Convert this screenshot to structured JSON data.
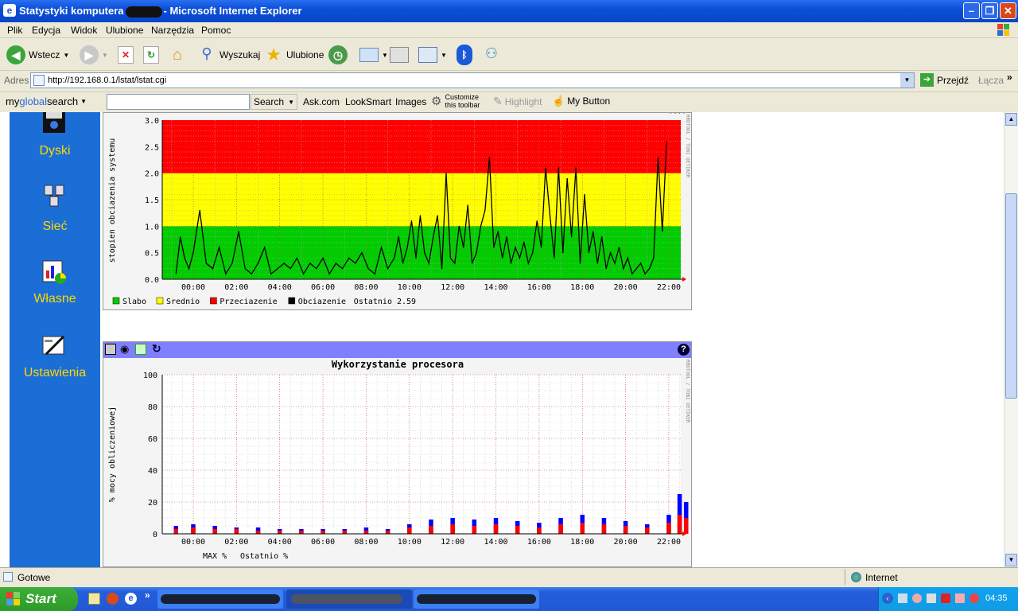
{
  "window": {
    "title_before": "Statystyki komputera",
    "title_after": "- Microsoft Internet Explorer"
  },
  "menu": [
    "Plik",
    "Edycja",
    "Widok",
    "Ulubione",
    "Narzędzia",
    "Pomoc"
  ],
  "toolbar": {
    "back_label": "Wstecz",
    "search_label": "Wyszukaj",
    "favorites_label": "Ulubione"
  },
  "address": {
    "label": "Adres",
    "url": "http://192.168.0.1/lstat/lstat.cgi",
    "go_label": "Przejdź",
    "links_label": "Łącza"
  },
  "searchbar": {
    "brand_my": "my",
    "brand_global": "global",
    "brand_search": "search",
    "search_button": "Search",
    "ask": "Ask.com",
    "looksmart": "LookSmart",
    "images": "Images",
    "customize_line1": "Customize",
    "customize_line2": "this toolbar",
    "highlight": "Highlight",
    "mybutton": "My Button"
  },
  "nav": [
    {
      "label": "Dyski",
      "icon": "disk-icon"
    },
    {
      "label": "Sieć",
      "icon": "network-icon"
    },
    {
      "label": "Własne",
      "icon": "custom-chart-icon"
    },
    {
      "label": "Ustawienia",
      "icon": "settings-icon"
    }
  ],
  "load_chart": {
    "ylabel": "stopien obciazenia systemu",
    "watermark": "RRDTOOL / TOBI OETIKER",
    "legend": [
      {
        "label": "Slabo",
        "color": "#00cc00"
      },
      {
        "label": "Srednio",
        "color": "#ffff00"
      },
      {
        "label": "Przeciazenie",
        "color": "#ff0000"
      },
      {
        "label": "Obciazenie",
        "color": "#000000"
      }
    ],
    "last_label": "Ostatnio 2.59"
  },
  "cpu_chart": {
    "title": "Wykorzystanie procesora",
    "ylabel": "% mocy obliczeniowej",
    "watermark": "RRDTOOL / TOBI OETIKER",
    "legend_max": "MAX %",
    "legend_last": "Ostatnio %"
  },
  "status": {
    "text": "Gotowe",
    "zone": "Internet"
  },
  "taskbar": {
    "start_label": "Start",
    "clock": "04:35"
  },
  "colors": {
    "titlebar": "#0a4fd8",
    "nav_panel": "#1a6ed6",
    "nav_text": "#ffd700",
    "panel_header": "#8080ff"
  },
  "chart_data": [
    {
      "type": "area",
      "title": "",
      "ylabel": "stopien obciazenia systemu",
      "xlabel": "",
      "x_ticks": [
        "00:00",
        "02:00",
        "04:00",
        "06:00",
        "08:00",
        "10:00",
        "12:00",
        "14:00",
        "16:00",
        "18:00",
        "20:00",
        "22:00"
      ],
      "y_ticks": [
        "0.0",
        "0.5",
        "1.0",
        "1.5",
        "2.0",
        "2.5",
        "3.0"
      ],
      "ylim": [
        0,
        3
      ],
      "bands": [
        {
          "name": "Slabo",
          "from": 0,
          "to": 1,
          "color": "#00cc00"
        },
        {
          "name": "Srednio",
          "from": 1,
          "to": 2,
          "color": "#ffff00"
        },
        {
          "name": "Przeciazenie",
          "from": 2,
          "to": 3,
          "color": "#ff0000"
        }
      ],
      "series": [
        {
          "name": "Obciazenie",
          "color": "#000000",
          "x_hours": [
            -0.8,
            -0.6,
            -0.4,
            -0.2,
            0,
            0.3,
            0.6,
            0.9,
            1.2,
            1.5,
            1.8,
            2.1,
            2.4,
            2.7,
            3,
            3.3,
            3.6,
            3.9,
            4.2,
            4.5,
            4.8,
            5.1,
            5.4,
            5.7,
            6,
            6.3,
            6.6,
            6.9,
            7.2,
            7.5,
            7.8,
            8.1,
            8.4,
            8.7,
            9,
            9.3,
            9.5,
            9.7,
            9.9,
            10.1,
            10.3,
            10.5,
            10.7,
            10.9,
            11.1,
            11.3,
            11.5,
            11.7,
            11.9,
            12.1,
            12.3,
            12.5,
            12.7,
            12.9,
            13.1,
            13.3,
            13.5,
            13.7,
            13.9,
            14.1,
            14.3,
            14.5,
            14.7,
            14.9,
            15.1,
            15.3,
            15.5,
            15.7,
            15.9,
            16.1,
            16.3,
            16.5,
            16.7,
            16.9,
            17.1,
            17.3,
            17.5,
            17.7,
            17.9,
            18.1,
            18.3,
            18.5,
            18.7,
            18.9,
            19.1,
            19.3,
            19.5,
            19.7,
            19.9,
            20.1,
            20.3,
            20.5,
            20.7,
            20.9,
            21.1,
            21.3,
            21.5,
            21.7,
            21.9,
            22.1,
            22.3,
            22.5,
            22.7
          ],
          "values": [
            0.1,
            0.8,
            0.4,
            0.2,
            0.5,
            1.3,
            0.3,
            0.2,
            0.6,
            0.1,
            0.3,
            0.9,
            0.2,
            0.1,
            0.3,
            0.6,
            0.1,
            0.2,
            0.3,
            0.2,
            0.4,
            0.1,
            0.3,
            0.2,
            0.4,
            0.1,
            0.3,
            0.2,
            0.4,
            0.3,
            0.5,
            0.2,
            0.1,
            0.6,
            0.2,
            0.4,
            0.8,
            0.3,
            0.6,
            1.1,
            0.4,
            1.2,
            0.5,
            0.3,
            0.8,
            1.2,
            0.2,
            2.0,
            0.4,
            0.3,
            1.0,
            0.6,
            1.4,
            0.3,
            0.5,
            1.0,
            1.3,
            2.3,
            0.6,
            0.9,
            0.4,
            0.8,
            0.3,
            0.6,
            0.4,
            0.7,
            0.3,
            0.5,
            1.1,
            0.6,
            2.1,
            1.2,
            0.4,
            2.1,
            0.5,
            1.9,
            0.8,
            2.1,
            0.3,
            1.6,
            0.5,
            0.9,
            0.3,
            0.8,
            0.2,
            0.5,
            0.3,
            0.6,
            0.2,
            0.4,
            0.1,
            0.2,
            0.3,
            0.1,
            0.2,
            0.4,
            2.3,
            0.9,
            2.6
          ]
        }
      ]
    },
    {
      "type": "bar",
      "title": "Wykorzystanie procesora",
      "ylabel": "% mocy obliczeniowej",
      "xlabel": "",
      "x_ticks": [
        "00:00",
        "02:00",
        "04:00",
        "06:00",
        "08:00",
        "10:00",
        "12:00",
        "14:00",
        "16:00",
        "18:00",
        "20:00",
        "22:00"
      ],
      "y_ticks": [
        "0",
        "20",
        "40",
        "60",
        "80",
        "100"
      ],
      "ylim": [
        0,
        100
      ],
      "series": [
        {
          "name": "MAX %",
          "color": "#0000ff",
          "x_hours": [
            -0.8,
            0,
            1,
            2,
            3,
            4,
            5,
            6,
            7,
            8,
            9,
            10,
            11,
            12,
            13,
            14,
            15,
            16,
            17,
            18,
            19,
            20,
            21,
            22,
            22.5,
            22.8
          ],
          "values": [
            5,
            6,
            5,
            4,
            4,
            3,
            3,
            3,
            3,
            4,
            3,
            6,
            9,
            10,
            9,
            10,
            8,
            7,
            10,
            12,
            10,
            8,
            6,
            12,
            25,
            20
          ]
        },
        {
          "name": "Ostatnio %",
          "color": "#ff0000",
          "x_hours": [
            -0.8,
            0,
            1,
            2,
            3,
            4,
            5,
            6,
            7,
            8,
            9,
            10,
            11,
            12,
            13,
            14,
            15,
            16,
            17,
            18,
            19,
            20,
            21,
            22,
            22.5,
            22.8
          ],
          "values": [
            3,
            4,
            3,
            3,
            2,
            2,
            2,
            2,
            2,
            2,
            2,
            4,
            5,
            6,
            5,
            6,
            5,
            4,
            6,
            7,
            6,
            5,
            4,
            7,
            12,
            10
          ]
        }
      ]
    }
  ]
}
